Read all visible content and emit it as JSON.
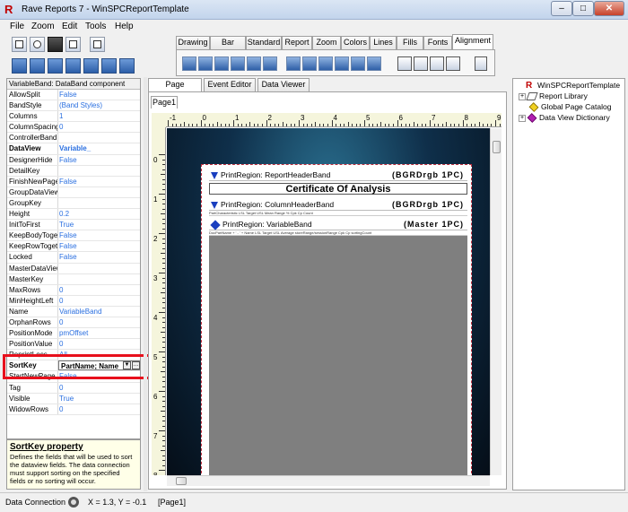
{
  "window": {
    "title": "Rave Reports 7 - WinSPCReportTemplate"
  },
  "menu": [
    "File",
    "Zoom",
    "Edit",
    "Tools",
    "Help"
  ],
  "tool_tabs": [
    "Drawing",
    "Bar Code",
    "Standard",
    "Report",
    "Zoom",
    "Colors",
    "Lines",
    "Fills",
    "Fonts",
    "Alignment"
  ],
  "properties": {
    "header": "VariableBand: DataBand component",
    "rows": [
      {
        "name": "AllowSplit",
        "value": "False"
      },
      {
        "name": "BandStyle",
        "value": "(Band Styles)"
      },
      {
        "name": "Columns",
        "value": "1"
      },
      {
        "name": "ColumnSpacing",
        "value": "0"
      },
      {
        "name": "ControllerBand",
        "value": ""
      },
      {
        "name": "DataView",
        "value": "Variable_"
      },
      {
        "name": "DesignerHide",
        "value": "False"
      },
      {
        "name": "DetailKey",
        "value": ""
      },
      {
        "name": "FinishNewPage",
        "value": "False"
      },
      {
        "name": "GroupDataView",
        "value": ""
      },
      {
        "name": "GroupKey",
        "value": ""
      },
      {
        "name": "Height",
        "value": "0.2"
      },
      {
        "name": "InitToFirst",
        "value": "True"
      },
      {
        "name": "KeepBodyTogether",
        "value": "False"
      },
      {
        "name": "KeepRowTogether",
        "value": "False"
      },
      {
        "name": "Locked",
        "value": "False"
      },
      {
        "name": "MasterDataView",
        "value": ""
      },
      {
        "name": "MasterKey",
        "value": ""
      },
      {
        "name": "MaxRows",
        "value": "0"
      },
      {
        "name": "MinHeightLeft",
        "value": "0"
      },
      {
        "name": "Name",
        "value": "VariableBand"
      },
      {
        "name": "OrphanRows",
        "value": "0"
      },
      {
        "name": "PositionMode",
        "value": "pmOffset"
      },
      {
        "name": "PositionValue",
        "value": "0"
      },
      {
        "name": "ReprintLocs",
        "value": "All"
      },
      {
        "name": "SortKey",
        "value": "PartName; Name"
      },
      {
        "name": "StartNewPage",
        "value": "False"
      },
      {
        "name": "Tag",
        "value": "0"
      },
      {
        "name": "Visible",
        "value": "True"
      },
      {
        "name": "WidowRows",
        "value": "0"
      }
    ],
    "description_title": "SortKey property",
    "description_text": "Defines the fields that will be used to sort the dataview fields.  The data connection must support sorting on the specified fields or no sorting will occur."
  },
  "design_tabs": [
    "Page Designer",
    "Event Editor",
    "Data Viewer"
  ],
  "page_tab": "Page1",
  "ruler_h": [
    "-1",
    "0",
    "1",
    "2",
    "3",
    "4",
    "5",
    "6",
    "7",
    "8",
    "9"
  ],
  "ruler_v": [
    "0",
    "1",
    "2",
    "3",
    "4",
    "5",
    "6",
    "7",
    "8"
  ],
  "report": {
    "header_band": {
      "label": "PrintRegion: ReportHeaderBand",
      "tag": "(BGRDrgb 1PC)"
    },
    "title": "Certificate Of Analysis",
    "column_band": {
      "label": "PrintRegion: ColumnHeaderBand",
      "tag": "(BGRDrgb 1PC)"
    },
    "column_headers": "PartCharacteristic      LSL      Target      USL      Mean      Range      %      Cpk      Cp      Count",
    "variable_band": {
      "label": "PrintRegion: VariableBand",
      "tag": "(Master 1PC)"
    },
    "variable_headers": "DocPartName + ' - ' + Name      LSL      Target      USL      Average storeRange/sessionRange      Cpk      Cp      sortingCount"
  },
  "tree": [
    {
      "label": "WinSPCReportTemplate",
      "icon": "rave-icon"
    },
    {
      "label": "Report Library",
      "icon": "report-library-icon"
    },
    {
      "label": "Global Page Catalog",
      "icon": "page-catalog-icon"
    },
    {
      "label": "Data View Dictionary",
      "icon": "data-view-icon"
    }
  ],
  "status": {
    "connection": "Data Connection",
    "coords": "X = 1.3, Y = -0.1",
    "page": "[Page1]"
  }
}
